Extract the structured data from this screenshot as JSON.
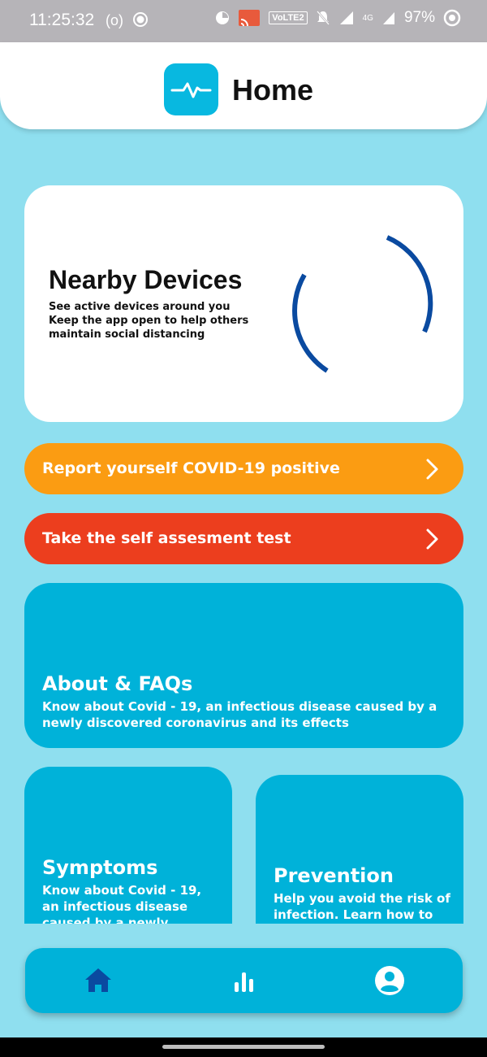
{
  "status_bar": {
    "time": "11:25:32",
    "volte": "VoLTE2",
    "network": "4G",
    "battery": "97%"
  },
  "header": {
    "title": "Home",
    "logo_icon": "heartbeat-icon"
  },
  "nearby": {
    "title": "Nearby Devices",
    "lines": [
      "See active devices around you",
      "Keep the app open to help others",
      "maintain social distancing"
    ]
  },
  "actions": [
    {
      "label": "Report yourself COVID-19 positive",
      "color": "#fb9c12"
    },
    {
      "label": "Take the self assesment test",
      "color": "#ec3e1e"
    }
  ],
  "about": {
    "title": "About & FAQs",
    "lines": [
      "Know about Covid - 19, an infectious disease caused by a",
      "newly discovered coronavirus and its effects"
    ]
  },
  "symptoms": {
    "title": "Symptoms",
    "lines": [
      "Know about Covid - 19,",
      "an infectious disease",
      "caused by a newly"
    ]
  },
  "prevention": {
    "title": "Prevention",
    "lines": [
      "Help you avoid the risk of",
      "infection. Learn how to"
    ]
  },
  "bottom_nav": [
    "home-icon",
    "stats-icon",
    "profile-icon"
  ],
  "colors": {
    "background": "#8fdfef",
    "accent": "#00b2d9",
    "active_icon": "#0a4aa0"
  }
}
